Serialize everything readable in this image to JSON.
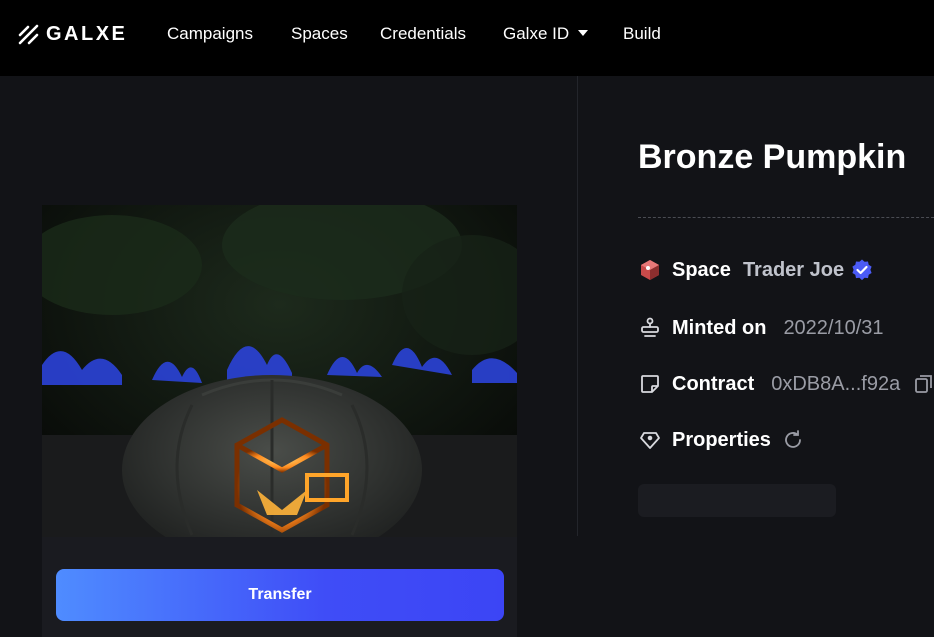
{
  "brand": {
    "name": "GALXE"
  },
  "nav": {
    "items": [
      {
        "label": "Campaigns"
      },
      {
        "label": "Spaces"
      },
      {
        "label": "Credentials"
      },
      {
        "label": "Galxe ID",
        "has_dropdown": true
      },
      {
        "label": "Build"
      }
    ]
  },
  "nft": {
    "title": "Bronze Pumpkin",
    "space_label": "Space",
    "space_name": "Trader Joe",
    "minted_label": "Minted on",
    "minted_date": "2022/10/31",
    "contract_label": "Contract",
    "contract_address": "0xDB8A...f92a",
    "properties_label": "Properties"
  },
  "actions": {
    "transfer_label": "Transfer"
  },
  "colors": {
    "accent_start": "#4f8cff",
    "accent_end": "#3c45f5",
    "verified": "#4b5bf5",
    "background": "#121317",
    "muted_text": "#9a9ca5"
  },
  "icons": {
    "logo": "galxe-slash-logo",
    "space": "trader-joe-avatar-icon",
    "verified": "verified-badge-icon",
    "minted": "stamp-icon",
    "contract": "note-icon",
    "properties": "tag-icon",
    "refresh": "refresh-icon",
    "copy": "copy-icon",
    "dropdown": "caret-down-icon"
  }
}
